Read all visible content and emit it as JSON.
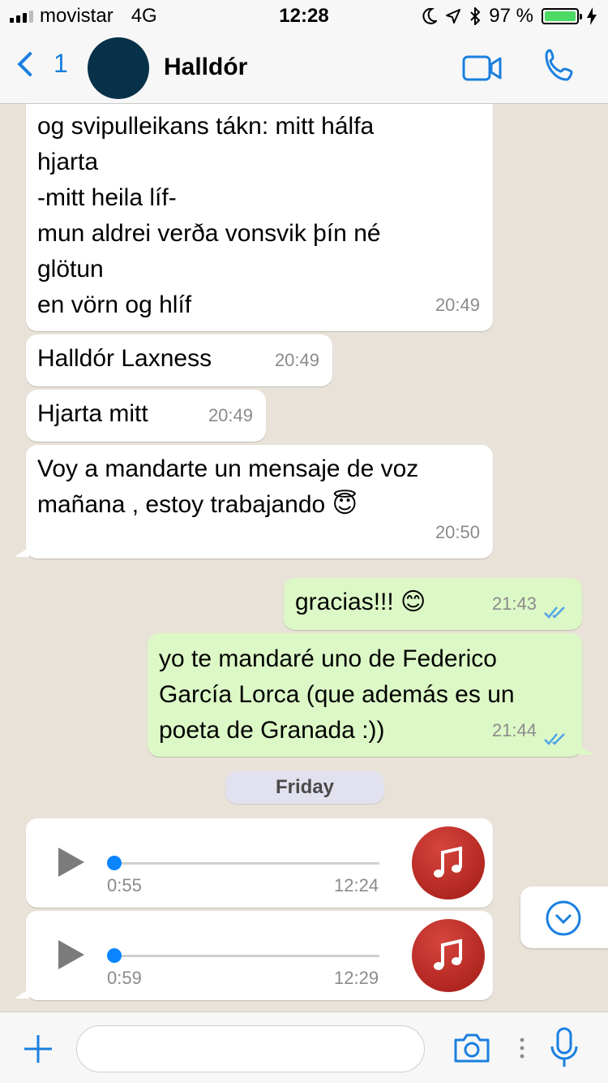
{
  "status_bar": {
    "carrier": "movistar",
    "network": "4G",
    "time": "12:28",
    "battery": "97 %"
  },
  "header": {
    "back_count": "1",
    "contact_name": "Halldór"
  },
  "messages": [
    {
      "direction": "in",
      "text": "og svipulleikans tákn: mitt hálfa\nhjarta\n-mitt heila líf-\nmun aldrei verða vonsvik þín né\nglötun\nen vörn og hlíf",
      "time": "20:49"
    },
    {
      "direction": "in",
      "text": "Halldór Laxness",
      "time": "20:49"
    },
    {
      "direction": "in",
      "text": "Hjarta mitt",
      "time": "20:49"
    },
    {
      "direction": "in",
      "text": "Voy a mandarte un mensaje de voz\nmañana , estoy trabajando 😇",
      "time": "20:50"
    },
    {
      "direction": "out",
      "text": "gracias!!! 😊",
      "time": "21:43"
    },
    {
      "direction": "out",
      "text": "yo te mandaré uno de Federico\nGarcía Lorca (que además es un\npoeta de Granada :))",
      "time": "21:44"
    }
  ],
  "day_separator": "Friday",
  "voice_messages": [
    {
      "duration": "0:55",
      "time": "12:24",
      "progress": 0.0
    },
    {
      "duration": "0:59",
      "time": "12:29",
      "progress": 0.0
    }
  ],
  "input": {
    "value": "",
    "placeholder": ""
  },
  "colors": {
    "accent": "#1a7fe0",
    "incoming_bubble": "#ffffff",
    "outgoing_bubble": "#dcf8c6",
    "read_ticks": "#4fa3e8",
    "chat_background": "#e9e2d8",
    "avatar": "#063149",
    "music_badge": "#c1302a"
  },
  "icons": [
    "back-chevron",
    "video-call",
    "phone",
    "read-receipt-double-tick",
    "play",
    "music-note",
    "scroll-down-chevron",
    "plus",
    "camera",
    "microphone"
  ]
}
